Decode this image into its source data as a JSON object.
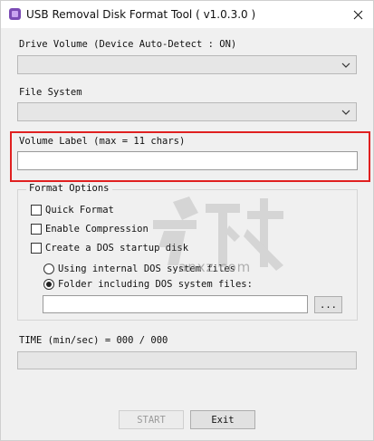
{
  "window": {
    "title": "USB Removal Disk Format Tool ( v1.0.3.0 )"
  },
  "drive": {
    "label": "Drive Volume  (Device Auto-Detect : ON)",
    "selected": ""
  },
  "filesystem": {
    "label": "File System",
    "selected": ""
  },
  "volume": {
    "label": "Volume Label (max = 11 chars)",
    "value": ""
  },
  "format_options": {
    "title": "Format Options",
    "quick_format": "Quick Format",
    "enable_compression": "Enable Compression",
    "create_dos_startup": "Create a DOS startup disk",
    "radio_internal": "Using internal DOS system files",
    "radio_folder": "Folder including DOS system files:",
    "folder_path": "",
    "browse_label": "..."
  },
  "time": {
    "label": "TIME (min/sec) = 000 / 000"
  },
  "buttons": {
    "start": "START",
    "exit": "Exit"
  },
  "watermark": {
    "text": "anxz.com"
  }
}
